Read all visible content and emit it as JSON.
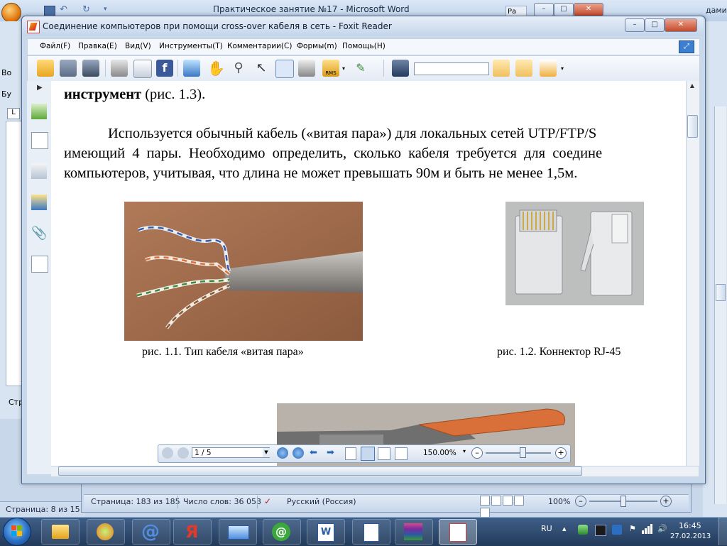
{
  "word_back": {
    "title": "Практическое занятие №17 - Microsoft Word",
    "left_tab_1": "Во",
    "left_tab_2": "Бу",
    "right_label_1": "Ра",
    "right_label_2": "дами",
    "status_page": "Страница: 8 из 15",
    "status_tab": "Стр"
  },
  "word_front": {
    "status": {
      "page": "Страница: 183 из 185",
      "words": "Число слов: 36 053",
      "language": "Русский (Россия)",
      "zoom": "100%"
    }
  },
  "foxit": {
    "title": "Соединение компьютеров при помощи cross-over кабеля в сеть - Foxit Reader",
    "menu": [
      "Файл(F)",
      "Правка(E)",
      "Вид(V)",
      "Инструменты(T)",
      "Комментарии(C)",
      "Формы(m)",
      "Помощь(H)"
    ],
    "search": {
      "value": ""
    },
    "toolbar_icons": [
      "open-icon",
      "save-icon",
      "save-as-icon",
      "print-icon",
      "email-icon",
      "facebook-icon",
      "monitor-icon",
      "hand-icon",
      "zoom-icon",
      "select-icon",
      "text-select-icon",
      "snapshot-icon",
      "rms-icon",
      "sign-icon",
      "binoculars-icon",
      "find-prev-icon",
      "find-next-icon",
      "highlight-icon"
    ],
    "document": {
      "line1_bold": "инструмент",
      "line1_rest": " (рис. 1.3).",
      "para_line1": "Используется обычный кабель («витая пара») для локальных сетей UTP/FTP/S",
      "para_line2": "имеющий 4 пары. Необходимо определить, сколько кабеля требуется для соедине",
      "para_line3": "компьютеров, учитывая, что длина не может превышать 90м и быть не менее 1,5м.",
      "caption1": "рис. 1.1. Тип кабеля  «витая пара»",
      "caption2": "рис. 1.2. Коннектор RJ-45"
    },
    "nav": {
      "page": "1 / 5",
      "zoom": "150.00%"
    }
  },
  "taskbar": {
    "language": "RU",
    "time": "16:45",
    "date": "27.02.2013",
    "apps": [
      "explorer",
      "chrome-like",
      "mail-ru-agent",
      "yandex",
      "mail",
      "icq",
      "word",
      "word-document",
      "winrar",
      "foxit-reader"
    ]
  },
  "colors": {
    "accent": "#3c7fd0",
    "titlebar": "#c4d5ea",
    "taskbar": "#223a5a",
    "cable_orange": "#d9703a"
  }
}
